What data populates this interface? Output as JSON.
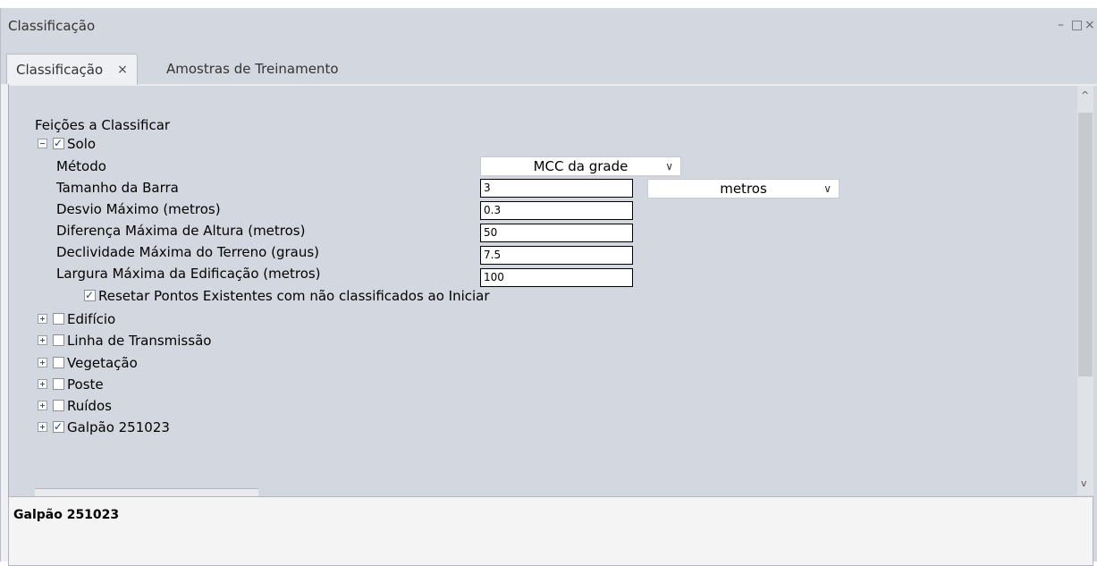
{
  "window": {
    "title": "Classificação",
    "controls": {
      "minimize": "–",
      "maximize": "□",
      "close": "×"
    }
  },
  "tabs": [
    {
      "label": "Classificação",
      "close": "×",
      "active": true
    },
    {
      "label": "Amostras de Treinamento",
      "active": false
    }
  ],
  "tree": {
    "heading": "Feições a Classificar",
    "solo": {
      "label": "Solo",
      "checked": true,
      "fields": {
        "metodo_label": "Método",
        "metodo_value": "MCC da grade",
        "tamanho_label": "Tamanho da Barra",
        "tamanho_value": "3",
        "tamanho_unit": "metros",
        "desvio_label": "Desvio Máximo (metros)",
        "desvio_value": "0.3",
        "diferenca_label": "Diferença Máxima de Altura (metros)",
        "diferenca_value": "50",
        "declividade_label": "Declividade Máxima do Terreno (graus)",
        "declividade_value": "7.5",
        "largura_label": "Largura Máxima da Edificação (metros)",
        "largura_value": "100",
        "resetar_label": "Resetar Pontos Existentes com não classificados ao Iniciar",
        "resetar_checked": true
      }
    },
    "items": [
      {
        "label": "Edifício",
        "checked": false
      },
      {
        "label": "Linha de Transmissão",
        "checked": false
      },
      {
        "label": "Vegetação",
        "checked": false
      },
      {
        "label": "Poste",
        "checked": false
      },
      {
        "label": "Ruídos",
        "checked": false
      },
      {
        "label": "Galpão 251023",
        "checked": true
      }
    ]
  },
  "scroll": {
    "up": "^",
    "down": "v"
  },
  "description": {
    "name": "Galpão 251023"
  }
}
